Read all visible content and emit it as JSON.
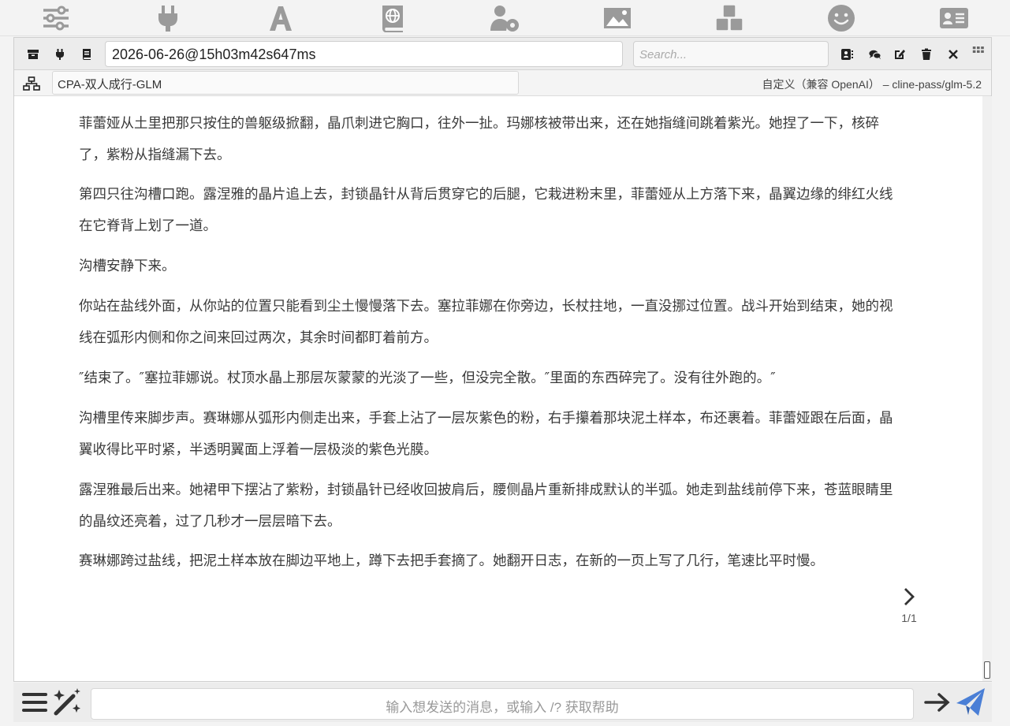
{
  "top_nav": {
    "icons": [
      "sliders-icon",
      "plug-icon",
      "font-icon",
      "book-globe-icon",
      "user-gear-icon",
      "image-icon",
      "cubes-icon",
      "smiley-icon",
      "id-card-icon"
    ]
  },
  "chat_header": {
    "chat_name": "2026-06-26@15h03m42s647ms",
    "search_placeholder": "Search..."
  },
  "character_row": {
    "character_name": "CPA-双人成行-GLM",
    "model_info": "自定义（兼容 OpenAI） – cline-pass/glm-5.2"
  },
  "message": {
    "paragraphs": [
      "菲蕾娅从土里把那只按住的兽躯级掀翻，晶爪刺进它胸口，往外一扯。玛娜核被带出来，还在她指缝间跳着紫光。她捏了一下，核碎了，紫粉从指缝漏下去。",
      "第四只往沟槽口跑。露涅雅的晶片追上去，封锁晶针从背后贯穿它的后腿，它栽进粉末里，菲蕾娅从上方落下来，晶翼边缘的绯红火线在它脊背上划了一道。",
      "沟槽安静下来。",
      "你站在盐线外面，从你站的位置只能看到尘土慢慢落下去。塞拉菲娜在你旁边，长杖拄地，一直没挪过位置。战斗开始到结束，她的视线在弧形内侧和你之间来回过两次，其余时间都盯着前方。",
      "″结束了。″塞拉菲娜说。杖顶水晶上那层灰蒙蒙的光淡了一些，但没完全散。″里面的东西碎完了。没有往外跑的。″",
      "沟槽里传来脚步声。赛琳娜从弧形内侧走出来，手套上沾了一层灰紫色的粉，右手攥着那块泥土样本，布还裹着。菲蕾娅跟在后面，晶翼收得比平时紧，半透明翼面上浮着一层极淡的紫色光膜。",
      "露涅雅最后出来。她裙甲下摆沾了紫粉，封锁晶针已经收回披肩后，腰侧晶片重新排成默认的半弧。她走到盐线前停下来，苍蓝眼睛里的晶纹还亮着，过了几秒才一层层暗下去。",
      "赛琳娜跨过盐线，把泥土样本放在脚边平地上，蹲下去把手套摘了。她翻开日志，在新的一页上写了几行，笔速比平时慢。"
    ],
    "swipe_counter": "1/1"
  },
  "input_bar": {
    "placeholder": "输入想发送的消息，或输入 /? 获取帮助"
  },
  "colors": {
    "icon_gray": "#9a9a9a",
    "icon_dark": "#222222",
    "send_blue": "#4a7fd6"
  }
}
